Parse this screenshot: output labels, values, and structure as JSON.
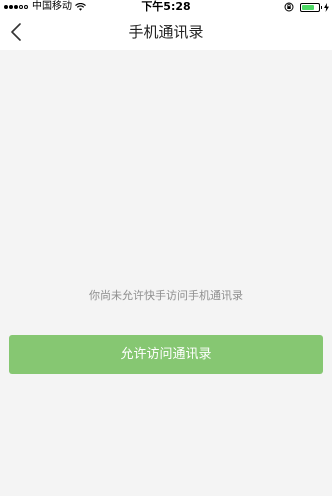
{
  "status_bar": {
    "carrier": "中国移动",
    "time": "下午5:28",
    "signal_bars_filled": 3,
    "signal_bars_total": 5,
    "battery_level": 0.75,
    "battery_color": "#4cd964"
  },
  "nav": {
    "title": "手机通讯录",
    "back_icon": "chevron-left-icon"
  },
  "main": {
    "message": "你尚未允许快手访问手机通讯录",
    "allow_button_label": "允许访问通讯录",
    "accent_color": "#86c772"
  }
}
